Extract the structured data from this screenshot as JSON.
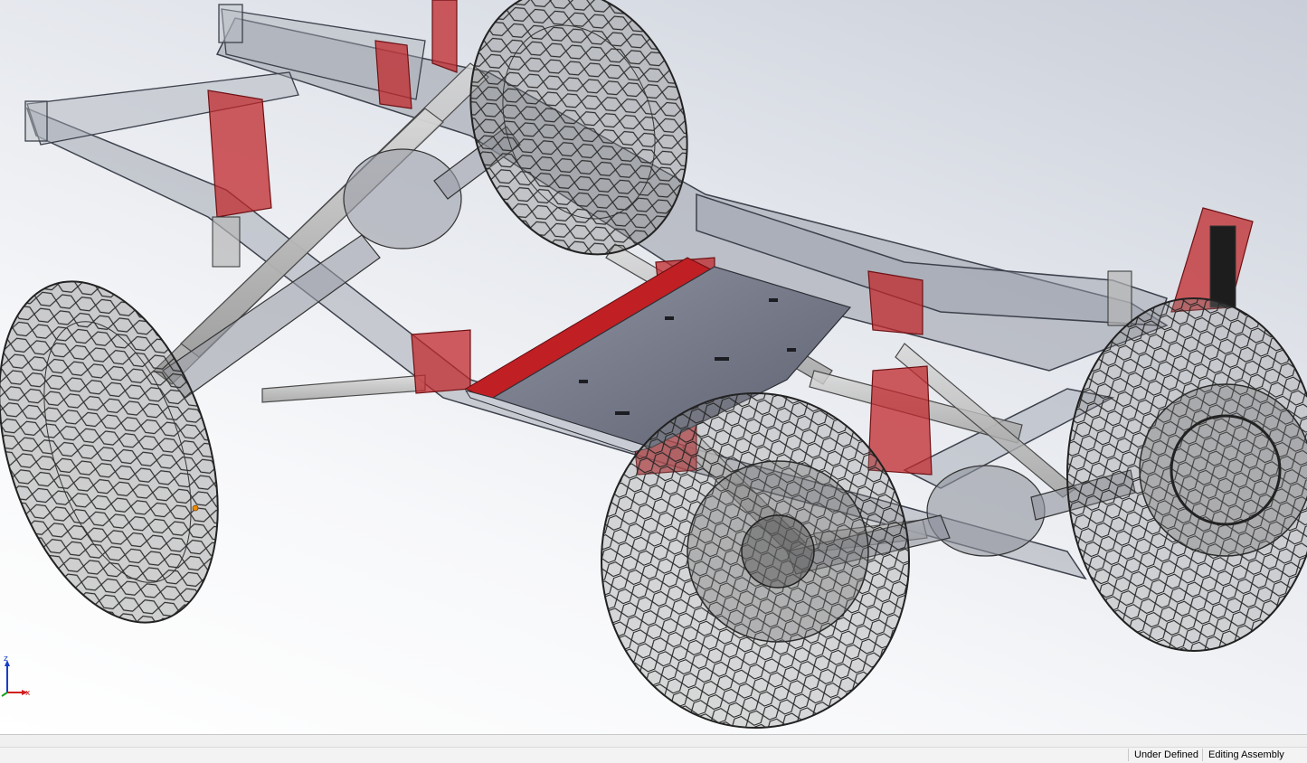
{
  "viewport": {
    "model_label": "suspension-assembly-model"
  },
  "triad": {
    "z_label": "z",
    "x_label": "x",
    "colors": {
      "z": "#1a3cc8",
      "x": "#d21e1e",
      "y": "#1fa01f"
    }
  },
  "status_bar": {
    "fields": [
      "Under Defined",
      "Editing Assembly"
    ]
  },
  "colors": {
    "frame": "#8a8f9a",
    "bracket_red": "#c0282c",
    "skid_plate": "#7a7e8c",
    "tire": "#3a3a3a"
  }
}
